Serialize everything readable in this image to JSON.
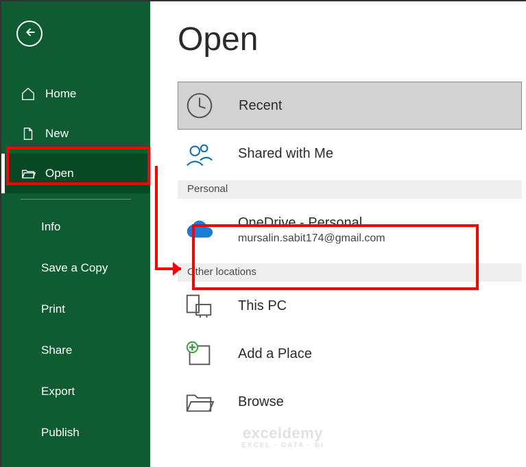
{
  "page_title": "Open",
  "sidebar": {
    "home": "Home",
    "new": "New",
    "open": "Open",
    "info": "Info",
    "save_copy": "Save a Copy",
    "print": "Print",
    "share": "Share",
    "export": "Export",
    "publish": "Publish"
  },
  "sections": {
    "personal": "Personal",
    "other_locations": "Other locations"
  },
  "locations": {
    "recent": "Recent",
    "shared": "Shared with Me",
    "onedrive_personal": {
      "label": "OneDrive - Personal",
      "email": "mursalin.sabit174@gmail.com"
    },
    "this_pc": "This PC",
    "add_place": "Add a Place",
    "browse": "Browse"
  },
  "watermark": {
    "main": "exceldemy",
    "sub": "EXCEL · DATA · BI"
  },
  "colors": {
    "sidebar": "#0f5c33",
    "annotation": "#ff0000",
    "onedrive_cloud": "#1a7ed6"
  }
}
